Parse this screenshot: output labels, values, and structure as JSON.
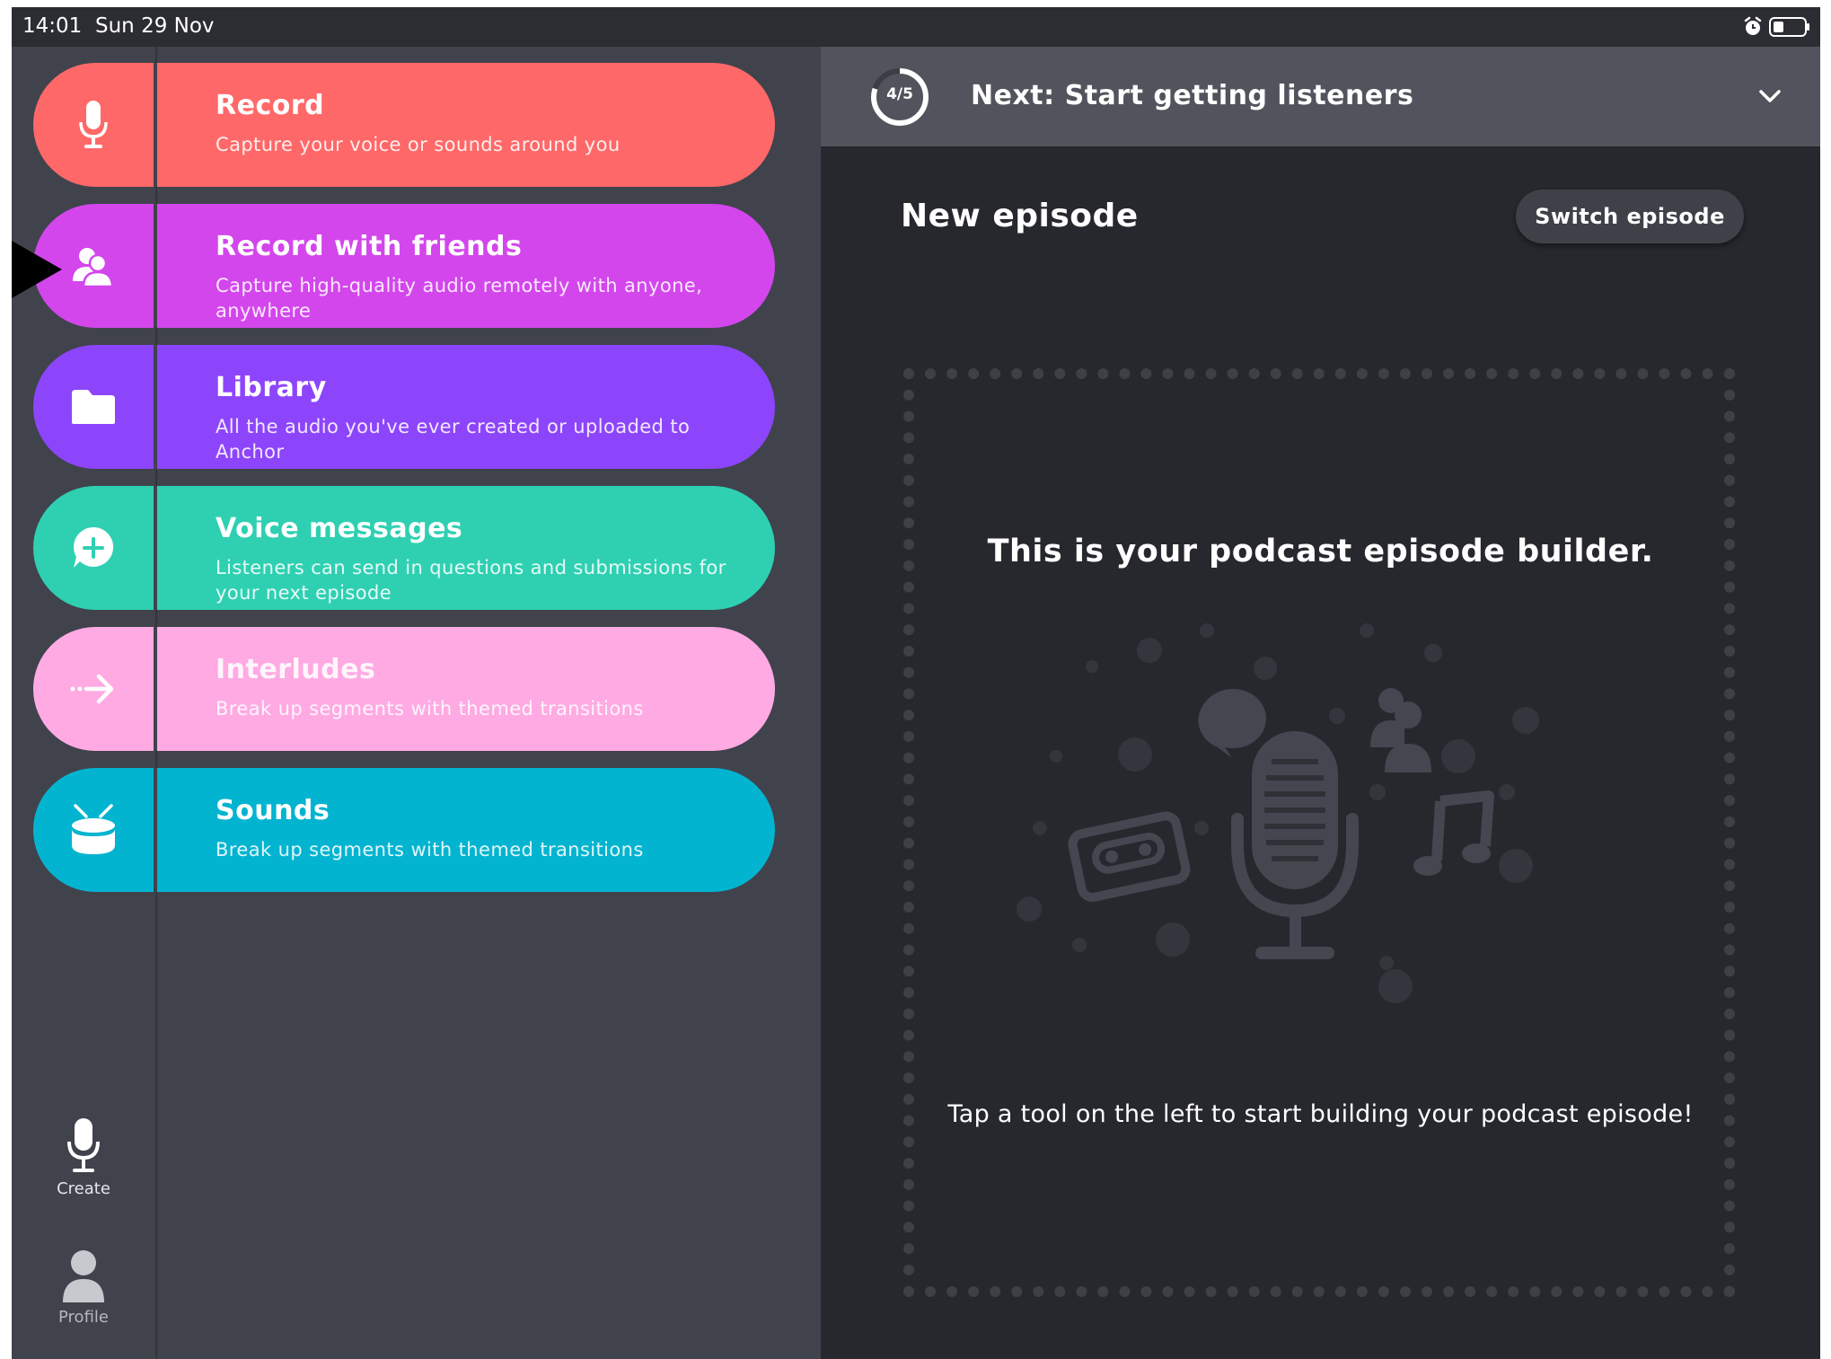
{
  "status_bar": {
    "time": "14:01",
    "date": "Sun 29 Nov",
    "icons": [
      "alarm-icon",
      "battery-icon"
    ]
  },
  "colors": {
    "record": "#ff6868",
    "record_with_friends": "#d346ec",
    "library": "#8d45fb",
    "voice_messages": "#2fd0b2",
    "interludes": "#ffaae3",
    "sounds": "#03b4d0",
    "background": "#40434c",
    "panel": "#26282e"
  },
  "tools": [
    {
      "title": "Record",
      "description": "Capture your voice or sounds around you",
      "icon": "microphone-icon"
    },
    {
      "title": "Record with friends",
      "description": "Capture high-quality audio remotely with anyone, anywhere",
      "icon": "friends-icon"
    },
    {
      "title": "Library",
      "description": "All the audio you've ever created or uploaded to Anchor",
      "icon": "folder-icon"
    },
    {
      "title": "Voice messages",
      "description": "Listeners can send in questions and submissions for your next episode",
      "icon": "add-message-icon"
    },
    {
      "title": "Interludes",
      "description": "Break up segments with themed transitions",
      "icon": "arrow-right-icon"
    },
    {
      "title": "Sounds",
      "description": "Break up segments with themed transitions",
      "icon": "drum-icon"
    }
  ],
  "nav": {
    "create_label": "Create",
    "profile_label": "Profile"
  },
  "next_step": {
    "progress": "4/5",
    "progress_fraction": 0.8,
    "text": "Next: Start getting listeners"
  },
  "episode": {
    "title": "New episode",
    "switch_label": "Switch episode",
    "builder_heading": "This is your podcast episode builder.",
    "builder_hint": "Tap a tool on the left to start building your podcast episode!"
  }
}
